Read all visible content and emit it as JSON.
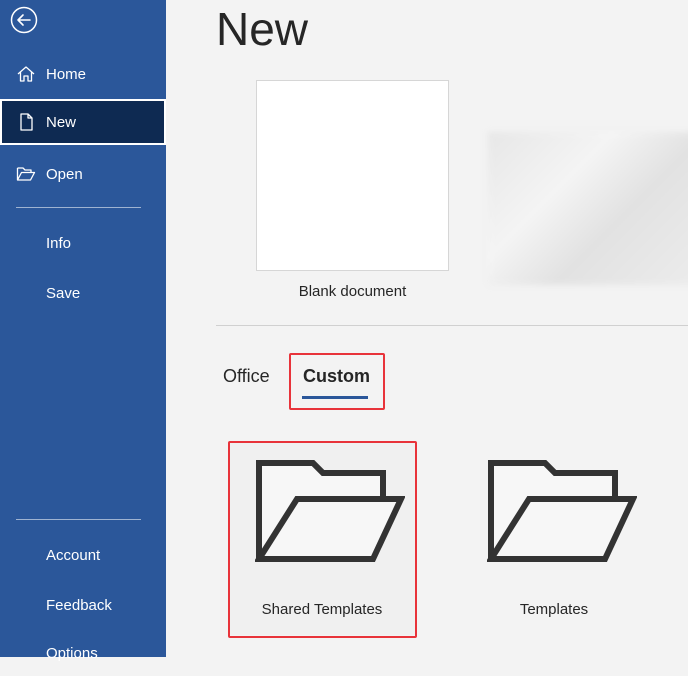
{
  "sidebar": {
    "items": [
      {
        "label": "Home"
      },
      {
        "label": "New"
      },
      {
        "label": "Open"
      },
      {
        "label": "Info"
      },
      {
        "label": "Save"
      },
      {
        "label": "Account"
      },
      {
        "label": "Feedback"
      },
      {
        "label": "Options"
      }
    ],
    "selected": "New",
    "colors": {
      "background": "#2b579a",
      "selected": "#0e2a52"
    }
  },
  "main": {
    "title": "New",
    "blank": {
      "label": "Blank document"
    },
    "tabs": [
      {
        "label": "Office"
      },
      {
        "label": "Custom"
      }
    ],
    "active_tab": "Custom",
    "tiles": [
      {
        "label": "Shared Templates"
      },
      {
        "label": "Templates"
      }
    ],
    "highlight_color": "#e8333a"
  }
}
